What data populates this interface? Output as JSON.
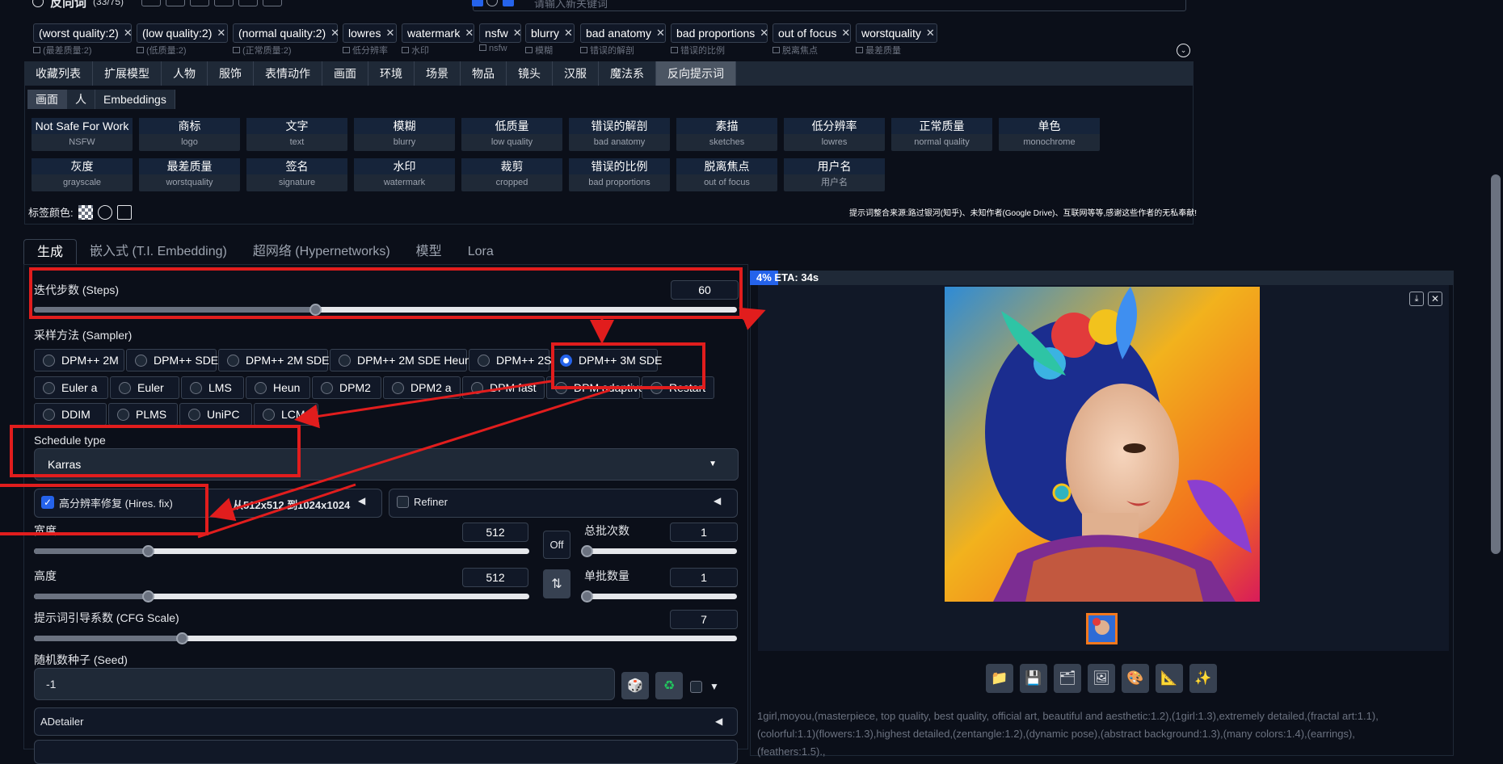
{
  "header": {
    "title": "反向词",
    "count": "(33/75)",
    "search_placeholder": "请输入新关键词"
  },
  "tags": [
    {
      "label": "(worst quality:2)",
      "sub": "(最差质量:2)"
    },
    {
      "label": "(low quality:2)",
      "sub": "(低质量:2)"
    },
    {
      "label": "(normal quality:2)",
      "sub": "(正常质量:2)"
    },
    {
      "label": "lowres",
      "sub": "低分辨率"
    },
    {
      "label": "watermark",
      "sub": "水印"
    },
    {
      "label": "nsfw",
      "sub": "nsfw"
    },
    {
      "label": "blurry",
      "sub": "模糊"
    },
    {
      "label": "bad anatomy",
      "sub": "错误的解剖"
    },
    {
      "label": "bad proportions",
      "sub": "错误的比例"
    },
    {
      "label": "out of focus",
      "sub": "脱离焦点"
    },
    {
      "label": "worstquality",
      "sub": "最差质量"
    }
  ],
  "categories": [
    "收藏列表",
    "扩展模型",
    "人物",
    "服饰",
    "表情动作",
    "画面",
    "环境",
    "场景",
    "物品",
    "镜头",
    "汉服",
    "魔法系",
    "反向提示词"
  ],
  "subtabs": [
    "画面",
    "人",
    "Embeddings"
  ],
  "prompt_tiles": [
    {
      "zh": "Not Safe For Work",
      "en": "NSFW"
    },
    {
      "zh": "商标",
      "en": "logo"
    },
    {
      "zh": "文字",
      "en": "text"
    },
    {
      "zh": "模糊",
      "en": "blurry"
    },
    {
      "zh": "低质量",
      "en": "low quality"
    },
    {
      "zh": "错误的解剖",
      "en": "bad anatomy"
    },
    {
      "zh": "素描",
      "en": "sketches"
    },
    {
      "zh": "低分辨率",
      "en": "lowres"
    },
    {
      "zh": "正常质量",
      "en": "normal quality"
    },
    {
      "zh": "单色",
      "en": "monochrome"
    },
    {
      "zh": "灰度",
      "en": "grayscale"
    },
    {
      "zh": "最差质量",
      "en": "worstquality"
    },
    {
      "zh": "签名",
      "en": "signature"
    },
    {
      "zh": "水印",
      "en": "watermark"
    },
    {
      "zh": "裁剪",
      "en": "cropped"
    },
    {
      "zh": "错误的比例",
      "en": "bad proportions"
    },
    {
      "zh": "脱离焦点",
      "en": "out of focus"
    },
    {
      "zh": "用户名",
      "en": "用户名"
    }
  ],
  "tag_color_label": "标签颜色:",
  "source_note": "提示词整合来源:路过银河(知乎)、未知作者(Google Drive)、互联网等等,感谢这些作者的无私奉献!",
  "main_tabs": [
    "生成",
    "嵌入式 (T.I. Embedding)",
    "超网络 (Hypernetworks)",
    "模型",
    "Lora"
  ],
  "steps": {
    "label": "迭代步数 (Steps)",
    "value": "60",
    "fraction": 0.4
  },
  "sampler": {
    "label": "采样方法 (Sampler)",
    "options": [
      "DPM++ 2M",
      "DPM++ SDE",
      "DPM++ 2M SDE",
      "DPM++ 2M SDE Heun",
      "DPM++ 2S a",
      "DPM++ 3M SDE",
      "Euler a",
      "Euler",
      "LMS",
      "Heun",
      "DPM2",
      "DPM2 a",
      "DPM fast",
      "DPM adaptive",
      "Restart",
      "DDIM",
      "PLMS",
      "UniPC",
      "LCM"
    ],
    "selected": "DPM++ 3M SDE"
  },
  "schedule": {
    "label": "Schedule type",
    "value": "Karras"
  },
  "hires": {
    "label": "高分辨率修复 (Hires. fix)",
    "checked": true,
    "summary": "从512x512 到1024x1024"
  },
  "refiner": {
    "label": "Refiner",
    "checked": false
  },
  "width": {
    "label": "宽度",
    "value": "512",
    "fraction": 0.23
  },
  "height": {
    "label": "高度",
    "value": "512",
    "fraction": 0.23
  },
  "batch_count": {
    "label": "总批次数",
    "value": "1",
    "fraction": 0.0
  },
  "batch_size": {
    "label": "单批数量",
    "value": "1",
    "fraction": 0.0
  },
  "off_button": "Off",
  "cfg": {
    "label": "提示词引导系数 (CFG Scale)",
    "value": "7",
    "fraction": 0.21
  },
  "seed": {
    "label": "随机数种子 (Seed)",
    "value": "-1"
  },
  "adetailer": {
    "label": "ADetailer"
  },
  "progress": {
    "text": "4% ETA: 34s",
    "percent": 4
  },
  "output_prompt": "1girl,moyou,(masterpiece, top quality, best quality, official art, beautiful and aesthetic:1.2),(1girl:1.3),extremely detailed,(fractal art:1.1),(colorful:1.1)(flowers:1.3),highest detailed,(zentangle:1.2),(dynamic pose),(abstract background:1.3),(many colors:1.4),(earrings),(feathers:1.5).,",
  "colors": {
    "bg": "#0b0f19",
    "accent": "#2563eb",
    "annotation": "#e11d1d"
  }
}
